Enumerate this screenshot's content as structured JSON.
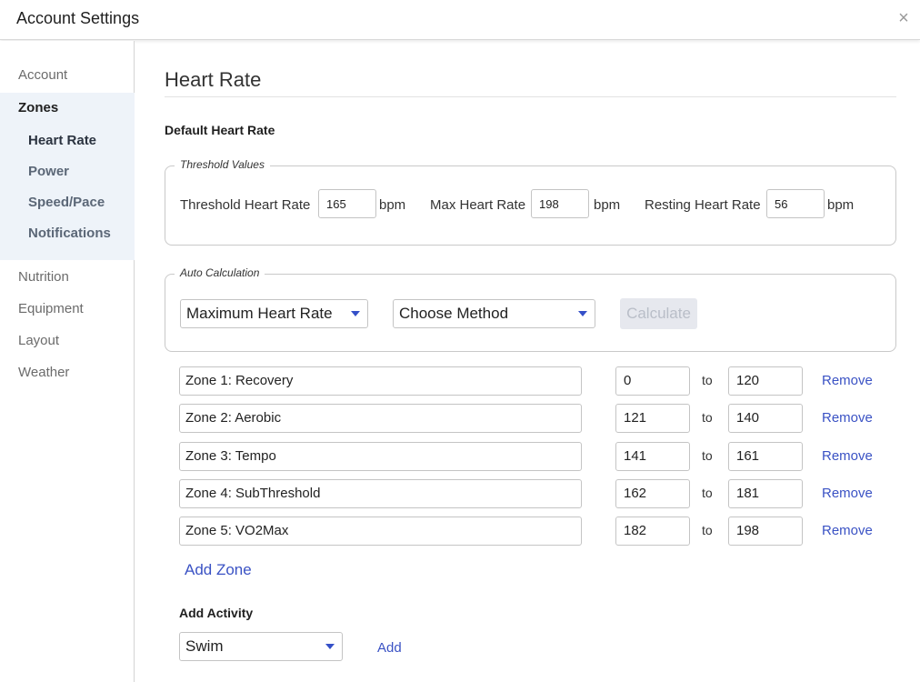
{
  "window": {
    "title": "Account Settings",
    "close_symbol": "×"
  },
  "sidebar": {
    "items_top": [
      {
        "label": "Account"
      }
    ],
    "zones": {
      "label": "Zones",
      "subitems": [
        {
          "label": "Heart Rate",
          "active": true
        },
        {
          "label": "Power"
        },
        {
          "label": "Speed/Pace"
        },
        {
          "label": "Notifications"
        }
      ]
    },
    "items_bottom": [
      {
        "label": "Nutrition"
      },
      {
        "label": "Equipment"
      },
      {
        "label": "Layout"
      },
      {
        "label": "Weather"
      }
    ]
  },
  "main": {
    "title": "Heart Rate",
    "section_title": "Default Heart Rate",
    "threshold_values": {
      "legend": "Threshold Values",
      "threshold_hr": {
        "label": "Threshold Heart Rate",
        "value": "165",
        "unit": "bpm"
      },
      "max_hr": {
        "label": "Max Heart Rate",
        "value": "198",
        "unit": "bpm"
      },
      "resting_hr": {
        "label": "Resting Heart Rate",
        "value": "56",
        "unit": "bpm"
      }
    },
    "auto_calc": {
      "legend": "Auto Calculation",
      "basis_select": "Maximum Heart Rate",
      "method_select": "Choose Method",
      "calculate_label": "Calculate"
    },
    "zones": [
      {
        "name": "Zone 1: Recovery",
        "min": "0",
        "to": "to",
        "max": "120",
        "remove": "Remove"
      },
      {
        "name": "Zone 2: Aerobic",
        "min": "121",
        "to": "to",
        "max": "140",
        "remove": "Remove"
      },
      {
        "name": "Zone 3: Tempo",
        "min": "141",
        "to": "to",
        "max": "161",
        "remove": "Remove"
      },
      {
        "name": "Zone 4: SubThreshold",
        "min": "162",
        "to": "to",
        "max": "181",
        "remove": "Remove"
      },
      {
        "name": "Zone 5: VO2Max",
        "min": "182",
        "to": "to",
        "max": "198",
        "remove": "Remove"
      }
    ],
    "add_zone_label": "Add Zone",
    "add_activity": {
      "title": "Add Activity",
      "activity_select": "Swim",
      "add_label": "Add"
    }
  },
  "colors": {
    "link": "#3a52c4",
    "caret": "#3550c8",
    "sidebar_highlight": "#eef3f9"
  }
}
